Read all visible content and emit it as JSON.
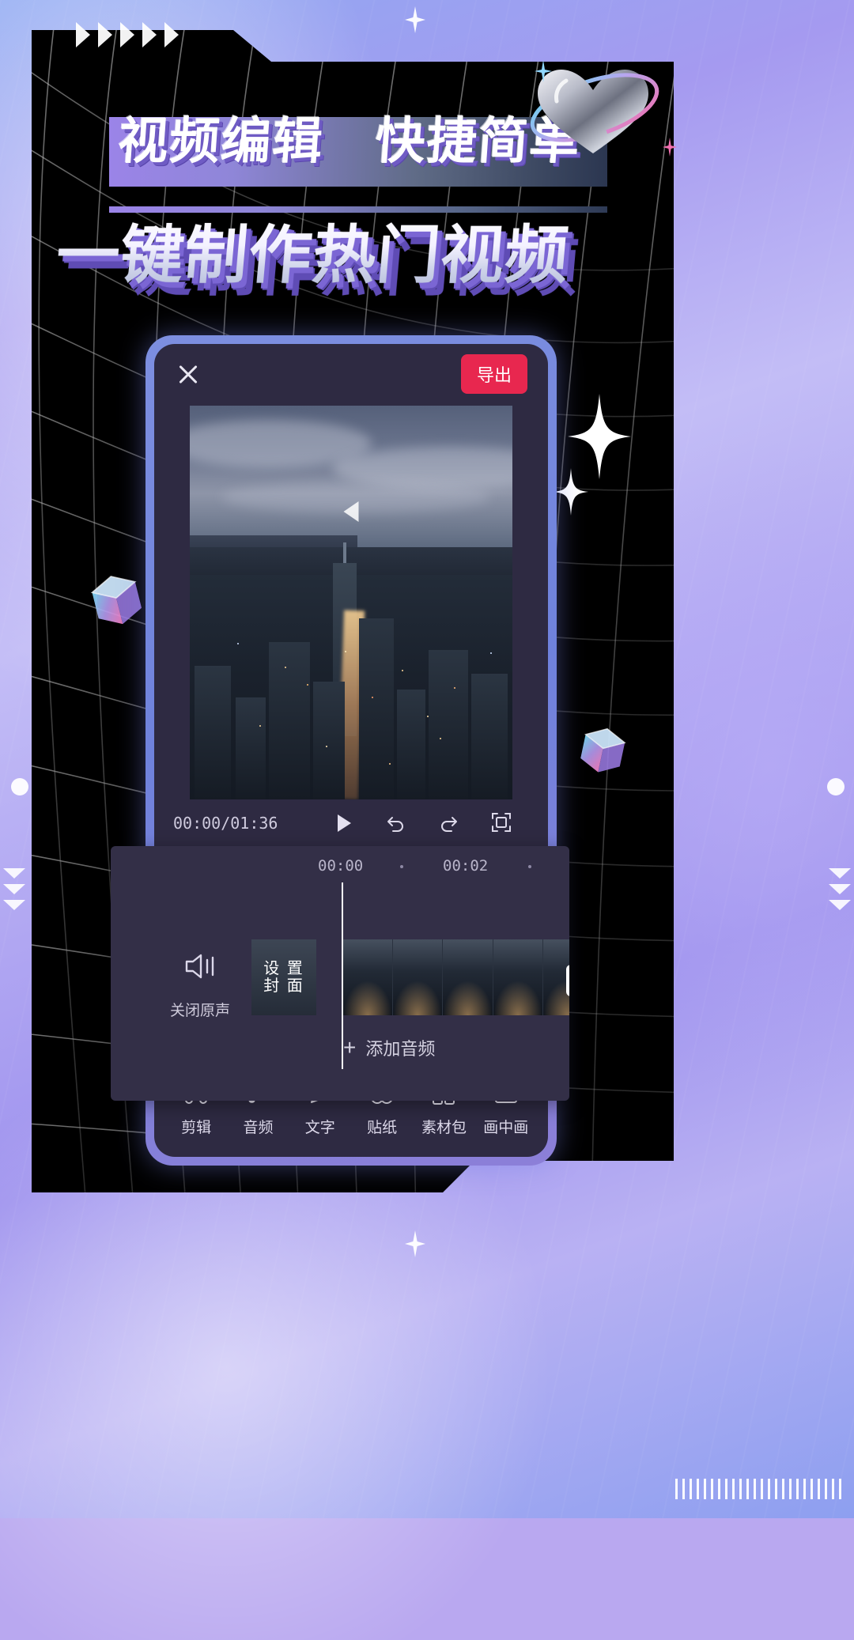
{
  "page": {
    "headline_main": "视频编辑　快捷简单",
    "headline_sub": "一键制作热门视频",
    "accent_purple": "#9b84e8",
    "accent_red": "#e8274f",
    "phone_frame_blue": "#6f82dc",
    "app_bg": "#2e2a42",
    "timeline_bg": "#332f47"
  },
  "app": {
    "header": {
      "close_icon": "close-icon",
      "export_label": "导出"
    },
    "preview": {
      "play_icon": "play-triangle-icon"
    },
    "controls": {
      "time_label": "00:00/01:36",
      "play_icon": "play-icon",
      "undo_icon": "undo-icon",
      "redo_icon": "redo-icon",
      "fullscreen_icon": "fullscreen-icon"
    },
    "timeline": {
      "ruler_labels": [
        "00:00",
        "00:02"
      ],
      "mute": {
        "icon": "speaker-mute-icon",
        "label": "关闭原声"
      },
      "cover": {
        "label": "设置\n封面",
        "label_line1": "设 置",
        "label_line2": "封 面"
      },
      "add_clip_label": "+",
      "add_audio": {
        "plus": "+",
        "label": "添加音频"
      }
    },
    "toolbar": [
      {
        "icon": "scissors-icon",
        "label": "剪辑"
      },
      {
        "icon": "music-note-icon",
        "label": "音频"
      },
      {
        "icon": "pencil-icon",
        "label": "文字"
      },
      {
        "icon": "sticker-circles-icon",
        "label": "贴纸"
      },
      {
        "icon": "material-pack-icon",
        "label": "素材包"
      },
      {
        "icon": "picture-in-picture-icon",
        "label": "画中画"
      }
    ]
  },
  "decor": {
    "arrows_icon": "right-arrows-icon",
    "chevrons_icon": "down-chevrons-icon",
    "heart_icon": "chrome-heart-icon",
    "cube_icon": "glass-cube-icon",
    "sparkle_icon": "four-point-sparkle-icon",
    "ticks_icon": "tick-marks-icon"
  }
}
